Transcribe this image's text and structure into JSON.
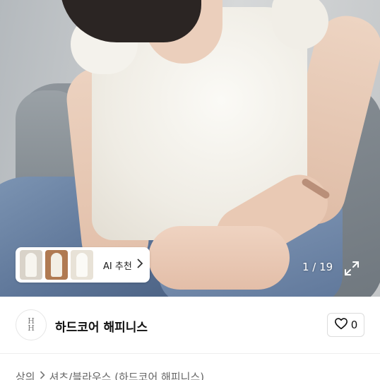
{
  "photo": {
    "ai_recommend_label": "AI 추천",
    "counter": "1 / 19"
  },
  "shop": {
    "logo_text_top": "H",
    "logo_text_bottom": "H",
    "name": "하드코어 해피니스",
    "like_count": "0"
  },
  "breadcrumb": {
    "home": "상의",
    "category": "셔츠/블라우스 (하드코어 해피니스)"
  },
  "icons": {
    "chevron": "chevron-right-icon",
    "expand": "expand-icon",
    "heart": "heart-outline-icon"
  }
}
